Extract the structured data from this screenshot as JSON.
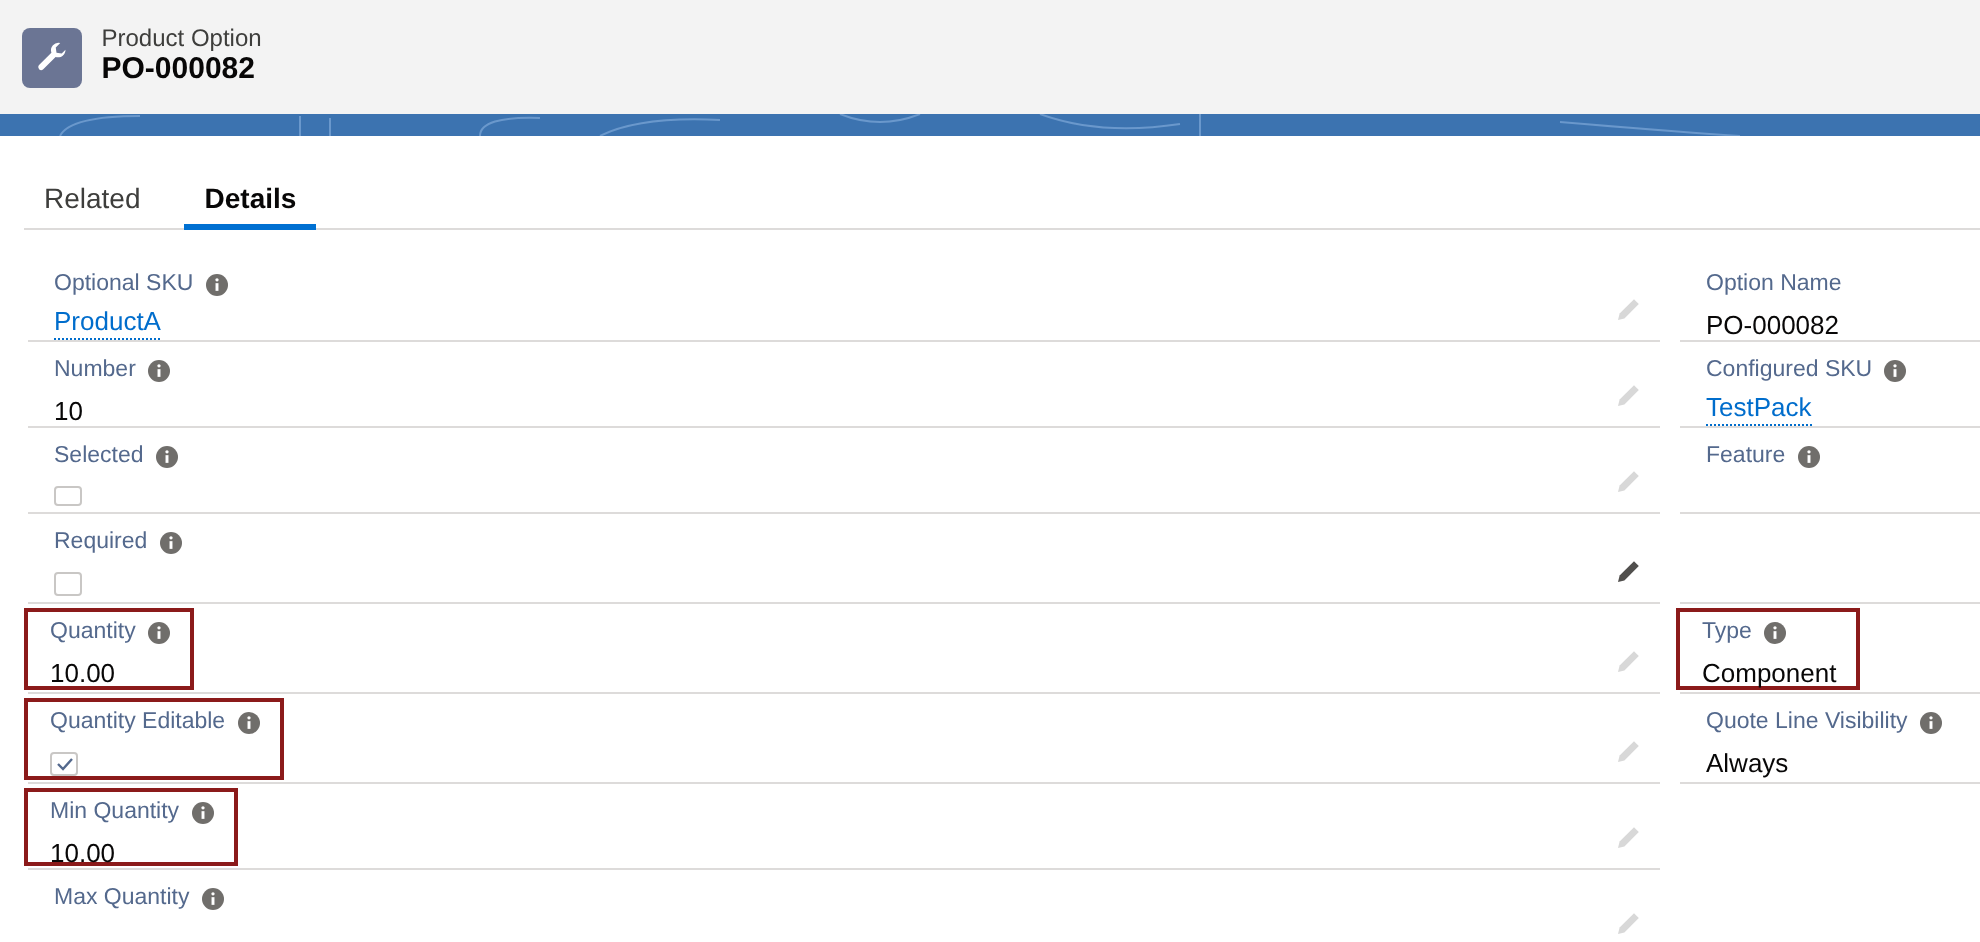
{
  "header": {
    "object_type": "Product Option",
    "record_name": "PO-000082"
  },
  "tabs": [
    {
      "label": "Related",
      "selected": false
    },
    {
      "label": "Details",
      "selected": true
    }
  ],
  "left_fields": [
    {
      "label": "Optional SKU",
      "info": true,
      "kind": "link",
      "value": "ProductA",
      "highlighted": false,
      "hovered": false
    },
    {
      "label": "Number",
      "info": true,
      "kind": "text",
      "value": "10",
      "highlighted": false,
      "hovered": false
    },
    {
      "label": "Selected",
      "info": true,
      "kind": "checkbox",
      "checked": false,
      "highlighted": false,
      "hovered": false
    },
    {
      "label": "Required",
      "info": true,
      "kind": "checkbox",
      "checked": false,
      "highlighted": false,
      "hovered": true
    },
    {
      "label": "Quantity",
      "info": true,
      "kind": "text",
      "value": "10.00",
      "highlighted": true,
      "hovered": false
    },
    {
      "label": "Quantity Editable",
      "info": true,
      "kind": "checkbox",
      "checked": true,
      "highlighted": true,
      "hovered": false
    },
    {
      "label": "Min Quantity",
      "info": true,
      "kind": "text",
      "value": "10.00",
      "highlighted": true,
      "hovered": false
    },
    {
      "label": "Max Quantity",
      "info": true,
      "kind": "text",
      "highlighted": false,
      "hovered": false
    }
  ],
  "right_fields": [
    {
      "label": "Option Name",
      "info": false,
      "kind": "text",
      "value": "PO-000082",
      "highlighted": false
    },
    {
      "label": "Configured SKU",
      "info": true,
      "kind": "link",
      "value": "TestPack",
      "highlighted": false
    },
    {
      "label": "Feature",
      "info": true,
      "kind": "text",
      "highlighted": false
    },
    {
      "kind": "blank",
      "highlighted": false
    },
    {
      "label": "Type",
      "info": true,
      "kind": "text",
      "value": "Component",
      "highlighted": true
    },
    {
      "label": "Quote Line Visibility",
      "info": true,
      "kind": "text",
      "value": "Always",
      "highlighted": false
    }
  ]
}
